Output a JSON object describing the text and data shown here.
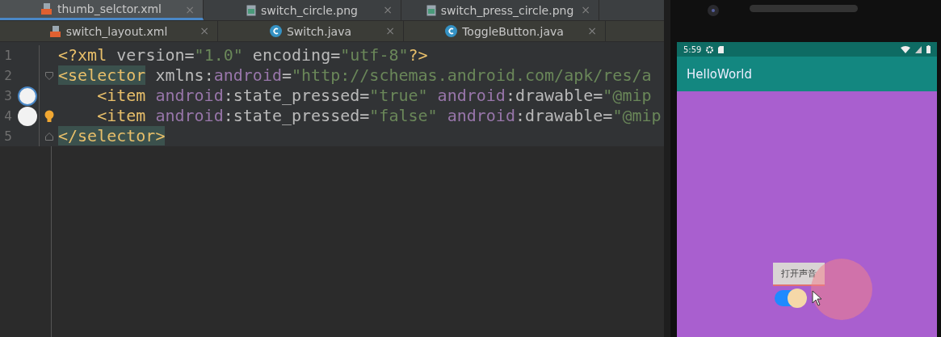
{
  "tab_rows": [
    {
      "tabs": [
        {
          "label": "thumb_selctor.xml",
          "kind": "xml",
          "close": "×",
          "selected": true
        },
        {
          "label": "switch_circle.png",
          "kind": "image",
          "close": "×",
          "selected": false
        },
        {
          "label": "switch_press_circle.png",
          "kind": "image",
          "close": "×",
          "selected": false
        }
      ]
    },
    {
      "tabs": [
        {
          "label": "switch_layout.xml",
          "kind": "xml",
          "close": "×",
          "selected": false
        },
        {
          "label": "Switch.java",
          "kind": "class",
          "close": "×",
          "selected": false
        },
        {
          "label": "ToggleButton.java",
          "kind": "class",
          "close": "×",
          "selected": false
        }
      ]
    }
  ],
  "code_lines": [
    {
      "number": "1",
      "bulb": false,
      "tokens": [
        {
          "kind": "tag",
          "text": "<?xml"
        },
        {
          "kind": "attr",
          "text": " version"
        },
        {
          "kind": "punct",
          "text": "="
        },
        {
          "kind": "value",
          "text": "\"1.0\""
        },
        {
          "kind": "attr",
          "text": " encoding"
        },
        {
          "kind": "punct",
          "text": "="
        },
        {
          "kind": "value",
          "text": "\"utf-8\""
        },
        {
          "kind": "tag",
          "text": "?>"
        }
      ]
    },
    {
      "number": "2",
      "fold": {
        "kind": "start"
      },
      "bulb": false,
      "tokens": [
        {
          "kind": "tag-match",
          "text": "<selector"
        },
        {
          "kind": "attr",
          "text": " xmlns"
        },
        {
          "kind": "punct",
          "text": ":"
        },
        {
          "kind": "ns",
          "text": "android"
        },
        {
          "kind": "punct",
          "text": "="
        },
        {
          "kind": "value",
          "text": "\"http://schemas.android.com/apk/res/a"
        }
      ]
    },
    {
      "number": "3",
      "gutter": {
        "kind": "ring"
      },
      "bulb": false,
      "tokens": [
        {
          "kind": "tag",
          "text": "    <item"
        },
        {
          "kind": "ns",
          "text": " android"
        },
        {
          "kind": "attr",
          "text": ":state_pressed"
        },
        {
          "kind": "punct",
          "text": "="
        },
        {
          "kind": "value",
          "text": "\"true\""
        },
        {
          "kind": "ns",
          "text": " android"
        },
        {
          "kind": "attr",
          "text": ":drawable"
        },
        {
          "kind": "punct",
          "text": "="
        },
        {
          "kind": "value",
          "text": "\"@mip"
        }
      ]
    },
    {
      "number": "4",
      "gutter": {
        "kind": "disc"
      },
      "bulb": true,
      "tokens": [
        {
          "kind": "tag",
          "text": "    <item"
        },
        {
          "kind": "ns",
          "text": " android"
        },
        {
          "kind": "attr",
          "text": ":state_pressed"
        },
        {
          "kind": "punct",
          "text": "="
        },
        {
          "kind": "value",
          "text": "\"false\""
        },
        {
          "kind": "ns",
          "text": " android"
        },
        {
          "kind": "attr",
          "text": ":drawable"
        },
        {
          "kind": "punct",
          "text": "="
        },
        {
          "kind": "value",
          "text": "\"@mip"
        }
      ]
    },
    {
      "number": "5",
      "fold": {
        "kind": "end"
      },
      "bulb": false,
      "tokens": [
        {
          "kind": "tag-match",
          "text": "</selector>"
        }
      ]
    }
  ],
  "phone": {
    "time": "5:59",
    "app_title": "HelloWorld",
    "toggle_button": {
      "label": "打开声音"
    },
    "switch": {
      "checked": true,
      "pressed": true
    }
  }
}
